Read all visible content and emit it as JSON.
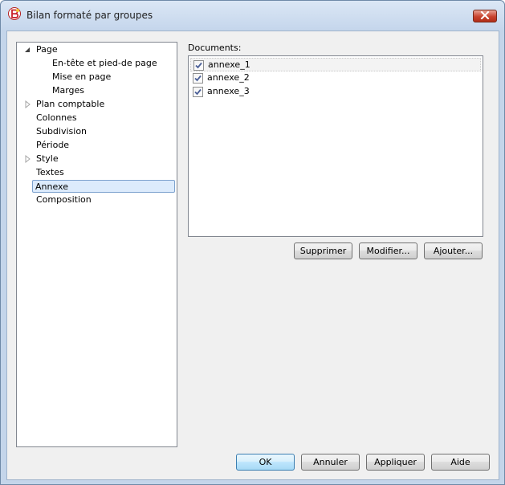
{
  "window": {
    "title": "Bilan formaté par groupes",
    "app_icon": "banana-app-icon",
    "close_icon": "close-icon"
  },
  "tree": {
    "items": [
      {
        "label": "Page",
        "level": 0,
        "expander": "expanded"
      },
      {
        "label": "En-tête et pied-de page",
        "level": 1,
        "expander": "none"
      },
      {
        "label": "Mise en page",
        "level": 1,
        "expander": "none"
      },
      {
        "label": "Marges",
        "level": 1,
        "expander": "none"
      },
      {
        "label": "Plan comptable",
        "level": 0,
        "expander": "collapsed"
      },
      {
        "label": "Colonnes",
        "level": 0,
        "expander": "none"
      },
      {
        "label": "Subdivision",
        "level": 0,
        "expander": "none"
      },
      {
        "label": "Période",
        "level": 0,
        "expander": "none"
      },
      {
        "label": "Style",
        "level": 0,
        "expander": "collapsed"
      },
      {
        "label": "Textes",
        "level": 0,
        "expander": "none"
      },
      {
        "label": "Annexe",
        "level": 0,
        "expander": "none",
        "selected": true
      },
      {
        "label": "Composition",
        "level": 0,
        "expander": "none"
      }
    ]
  },
  "documents": {
    "label": "Documents:",
    "items": [
      {
        "label": "annexe_1",
        "checked": true,
        "current": true
      },
      {
        "label": "annexe_2",
        "checked": true,
        "current": false
      },
      {
        "label": "annexe_3",
        "checked": true,
        "current": false
      }
    ],
    "buttons": {
      "delete": "Supprimer",
      "edit": "Modifier...",
      "add": "Ajouter..."
    }
  },
  "footer": {
    "ok": "OK",
    "cancel": "Annuler",
    "apply": "Appliquer",
    "help": "Aide"
  },
  "colors": {
    "selection_bg": "#dcebfc",
    "selection_border": "#7da2ce",
    "checkmark": "#4a5f97",
    "frame": "#c4d5ea"
  }
}
